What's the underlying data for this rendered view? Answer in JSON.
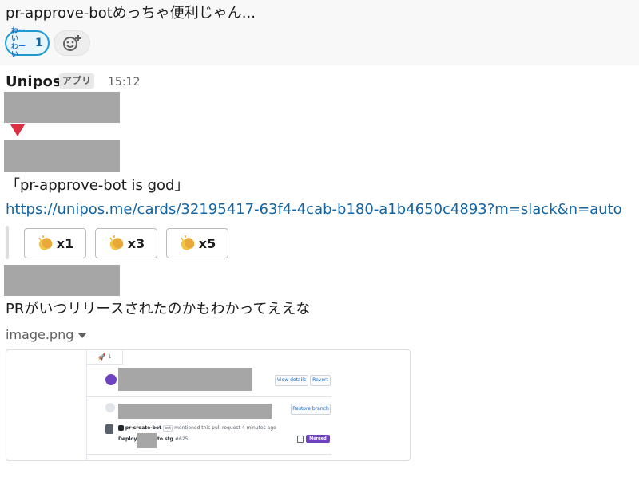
{
  "top_message": {
    "text": "pr-approve-botめっちゃ便利じゃん...",
    "reaction": {
      "emoji_line1": "わーい",
      "emoji_line2": "わーい",
      "count": "1"
    }
  },
  "message": {
    "sender": "Unipos",
    "badge": "アプリ",
    "time": "15:12",
    "quote": "「pr-approve-bot is god」",
    "link": "https://unipos.me/cards/32195417-63f4-4cab-b180-a1b4650c4893?m=slack&n=auto",
    "buttons": [
      {
        "label": "x1",
        "icon": "clapping-hands-icon"
      },
      {
        "label": "x3",
        "icon": "clapping-hands-icon"
      },
      {
        "label": "x5",
        "icon": "clapping-hands-icon"
      }
    ]
  },
  "message2": {
    "text": "PRがいつリリースされたのかもわかってええな",
    "file_name": "image.png"
  },
  "screenshot": {
    "rocket_count": "1",
    "view_details": "View details",
    "revert": "Revert",
    "restore_branch": "Restore branch",
    "bot_name": "pr-create-bot",
    "bot_badge": "bot",
    "mention_text": "mentioned this pull request 4 minutes ago",
    "deploy_label": "Deploy",
    "deploy_target": "to stg",
    "deploy_number": "#625",
    "merged_label": "Merged"
  },
  "colors": {
    "accent": "#1264a3",
    "reaction_border": "#1d9bd1",
    "merged": "#6f42c1",
    "redaction": "#a6a6a6"
  }
}
